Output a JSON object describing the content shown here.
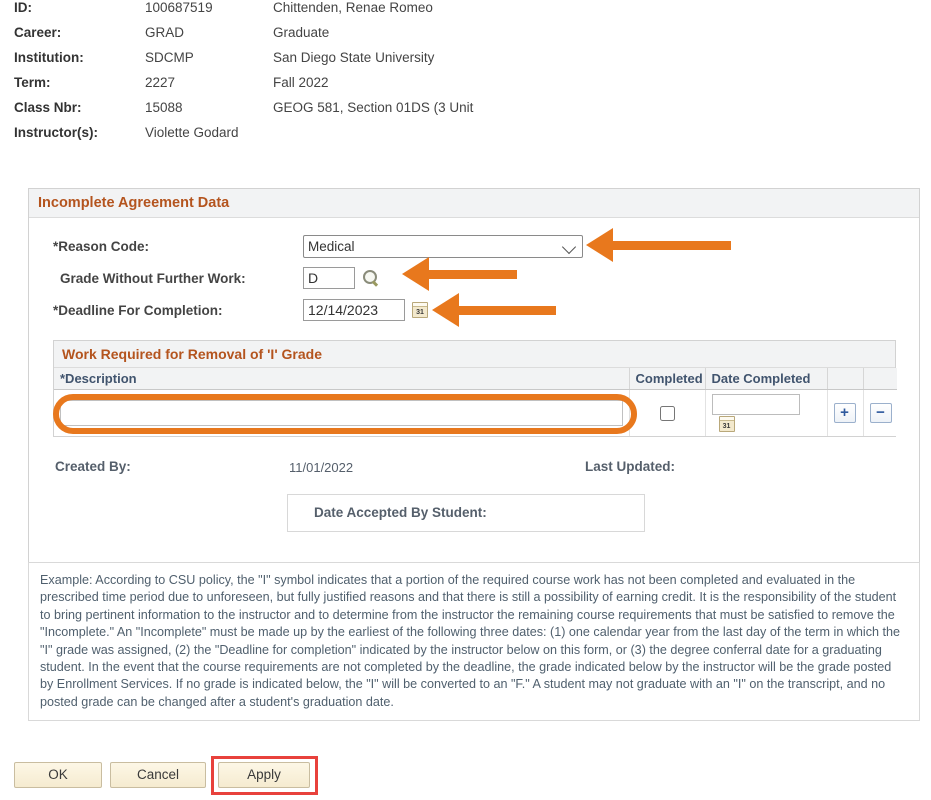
{
  "header": {
    "rows": [
      {
        "label": "ID:",
        "code": "100687519",
        "desc": "Chittenden, Renae Romeo"
      },
      {
        "label": "Career:",
        "code": "GRAD",
        "desc": "Graduate"
      },
      {
        "label": "Institution:",
        "code": "SDCMP",
        "desc": "San Diego State University"
      },
      {
        "label": "Term:",
        "code": "2227",
        "desc": "Fall 2022"
      },
      {
        "label": "Class Nbr:",
        "code": "15088",
        "desc": "GEOG 581, Section 01DS (3 Unit"
      },
      {
        "label": "Instructor(s):",
        "code": "Violette Godard",
        "desc": ""
      }
    ]
  },
  "agreement_panel": {
    "title": "Incomplete Agreement Data",
    "reason_code": {
      "label": "*Reason Code:",
      "value": "Medical",
      "options": [
        "Medical"
      ]
    },
    "grade_without_work": {
      "label": "Grade Without Further Work:",
      "value": "D",
      "lookup_icon": "magnifier-icon"
    },
    "deadline": {
      "label": "*Deadline For Completion:",
      "value": "12/14/2023",
      "calendar_icon": "calendar-icon",
      "calendar_glyph": "31"
    }
  },
  "work_grid": {
    "title": "Work Required for Removal of 'I' Grade",
    "columns": {
      "description": "*Description",
      "completed": "Completed",
      "date_completed": "Date Completed",
      "add": "+",
      "remove": "−"
    },
    "rows": [
      {
        "description": "",
        "description_placeholder": "",
        "completed": false,
        "date_completed": "",
        "date_completed_placeholder": ""
      }
    ]
  },
  "created_section": {
    "created_by_label": "Created By:",
    "created_by_value": "11/01/2022",
    "last_updated_label": "Last Updated:",
    "last_updated_value": "",
    "date_accepted_label": "Date Accepted By Student:"
  },
  "example": {
    "text": "Example: According to CSU policy, the \"I\" symbol indicates that a portion of the required course work has not been completed and evaluated in the prescribed time period due to unforeseen, but fully justified reasons and that there is still a possibility of earning credit. It is the responsibility of the student to bring pertinent information to the instructor and to determine from the instructor the remaining course requirements that must be satisfied to remove the \"Incomplete.\"  An \"Incomplete\" must be made up by the earliest of the following three dates: (1) one calendar year from the last day of the term in which the \"I\" grade was assigned, (2) the \"Deadline for completion\" indicated by the instructor below on this form, or (3) the degree conferral date for a graduating student.  In the event that the course requirements are not completed by the deadline, the grade indicated below by the instructor will be the grade posted by Enrollment Services.  If no grade is indicated below, the \"I\" will be converted to an \"F.\"  A student may not graduate with an \"I\" on the transcript, and no posted grade can be changed after a student's graduation date."
  },
  "footer": {
    "ok": "OK",
    "cancel": "Cancel",
    "apply": "Apply"
  },
  "annotations": {
    "arrow_color": "#e8781d",
    "highlight_color": "#e8781d",
    "apply_highlight_color": "#e8413c",
    "arrows": [
      {
        "name": "arrow-reason-code",
        "points_to": "reason-code-select"
      },
      {
        "name": "arrow-grade-lookup",
        "points_to": "grade-lookup-icon"
      },
      {
        "name": "arrow-deadline-calendar",
        "points_to": "deadline-calendar-icon"
      }
    ]
  }
}
